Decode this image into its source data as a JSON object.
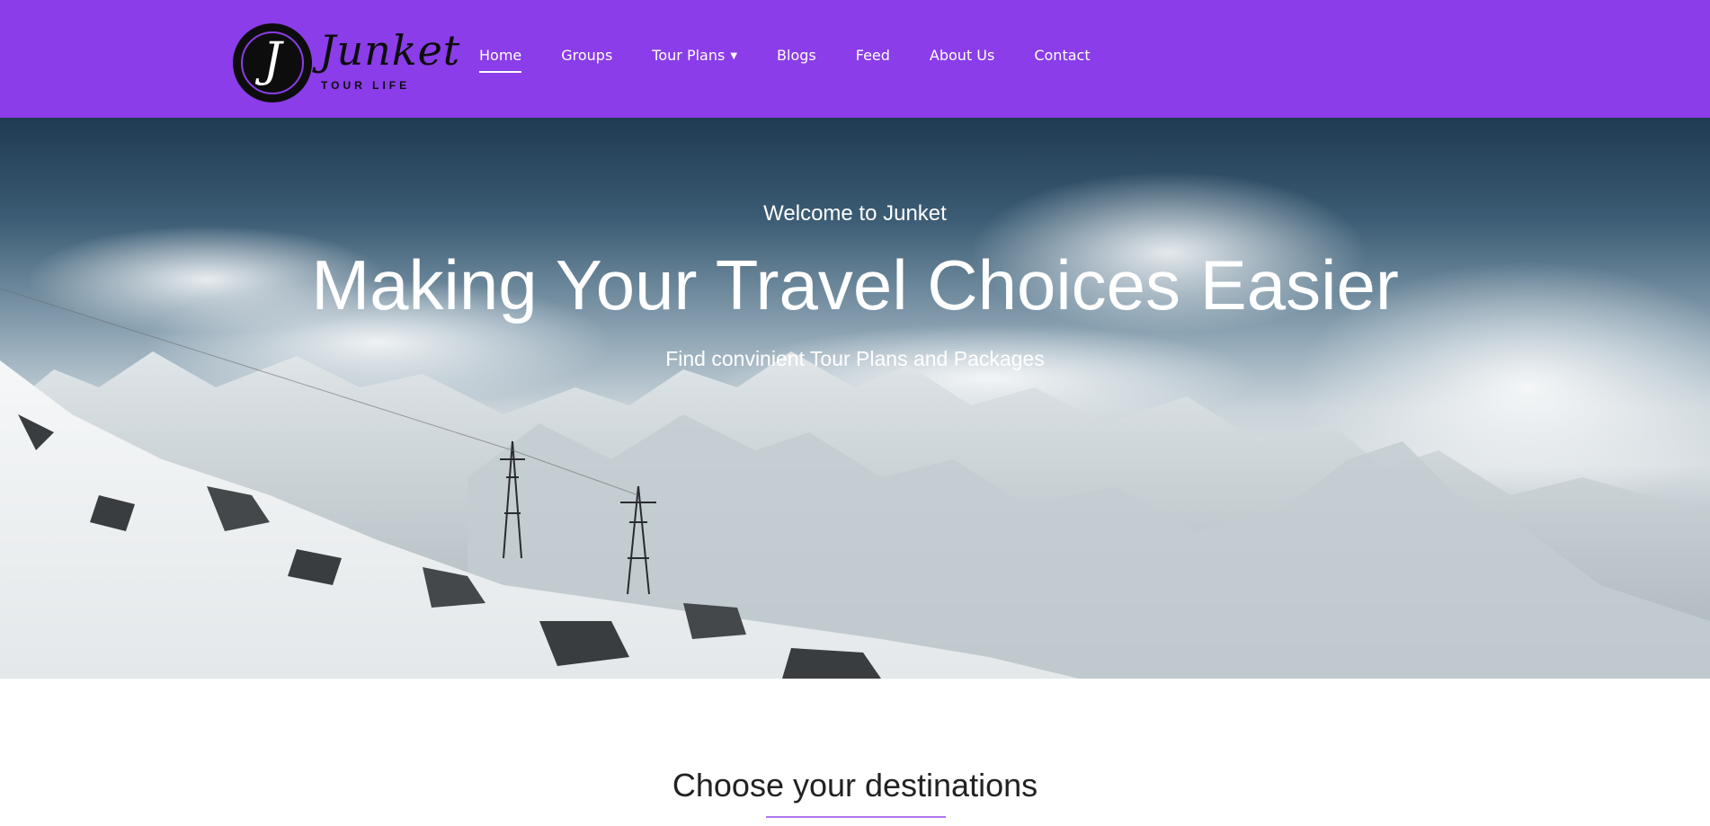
{
  "brand": {
    "logo_letter": "J",
    "logo_wordmark": "Junket",
    "logo_tagline": "TOUR LIFE",
    "header_color": "#8a3de8"
  },
  "nav": {
    "items": [
      {
        "label": "Home",
        "active": true
      },
      {
        "label": "Groups"
      },
      {
        "label": "Tour Plans",
        "has_dropdown": true,
        "icon": "chevron-down-icon"
      },
      {
        "label": "Blogs"
      },
      {
        "label": "Feed"
      },
      {
        "label": "About Us"
      },
      {
        "label": "Contact"
      }
    ]
  },
  "hero": {
    "eyebrow": "Welcome to Junket",
    "title": "Making Your Travel Choices Easier",
    "subtitle": "Find convinient Tour Plans and Packages",
    "background": "snowy-mountains-photo"
  },
  "section": {
    "title": "Choose your destinations"
  }
}
